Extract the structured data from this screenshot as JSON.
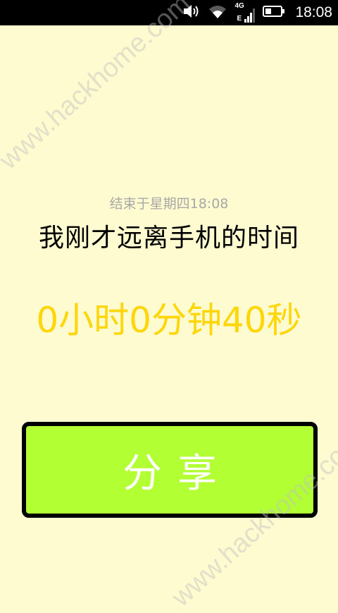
{
  "status_bar": {
    "time": "18:08",
    "network_top": "4G",
    "network_bottom": "E",
    "icons": [
      "volume-icon",
      "wifi-icon",
      "signal-icon",
      "battery-icon"
    ]
  },
  "main": {
    "end_time": "结束于星期四18:08",
    "heading": "我刚才远离手机的时间",
    "duration": "0小时0分钟40秒",
    "share_label": "分享"
  },
  "watermark": {
    "text": "www.hackhome.com"
  },
  "colors": {
    "background": "#fffbd0",
    "accent_text": "#ffd60a",
    "button_fill": "#b2ff33",
    "button_border": "#000000",
    "muted_text": "#a8a8a8"
  }
}
